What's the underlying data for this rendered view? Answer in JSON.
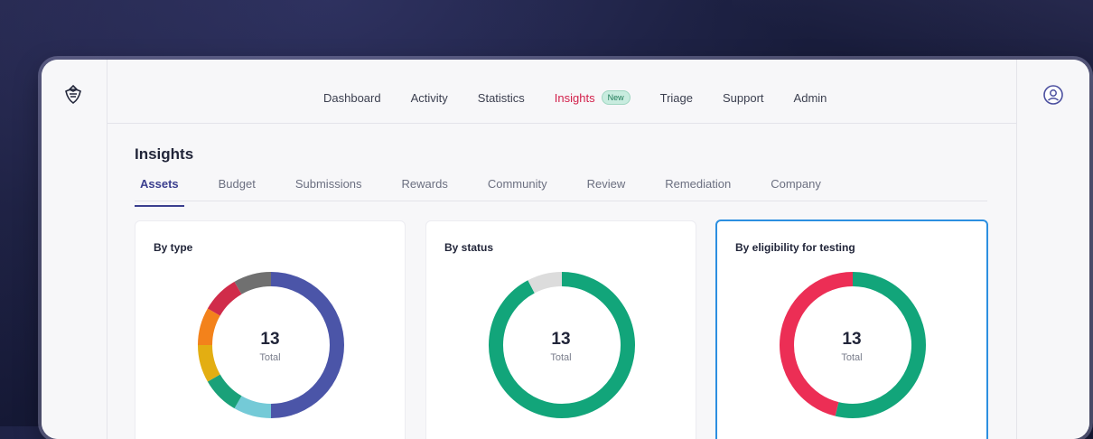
{
  "nav": {
    "items": [
      {
        "label": "Dashboard"
      },
      {
        "label": "Activity"
      },
      {
        "label": "Statistics"
      },
      {
        "label": "Insights",
        "badge": "New"
      },
      {
        "label": "Triage"
      },
      {
        "label": "Support"
      },
      {
        "label": "Admin"
      }
    ],
    "active_label": "Insights"
  },
  "page": {
    "title": "Insights"
  },
  "tabs": [
    "Assets",
    "Budget",
    "Submissions",
    "Rewards",
    "Community",
    "Review",
    "Remediation",
    "Company"
  ],
  "active_tab": "Assets",
  "cards": [
    {
      "title": "By type",
      "total": "13",
      "total_label": "Total",
      "segments": [
        {
          "value": 6,
          "color": "#4b55a8"
        },
        {
          "value": 1,
          "color": "#74cad7"
        },
        {
          "value": 1,
          "color": "#1aa179"
        },
        {
          "value": 1,
          "color": "#e3ae12"
        },
        {
          "value": 1,
          "color": "#f3821b"
        },
        {
          "value": 1,
          "color": "#d02c4a"
        },
        {
          "value": 1,
          "color": "#707070"
        }
      ]
    },
    {
      "title": "By status",
      "total": "13",
      "total_label": "Total",
      "segments": [
        {
          "value": 12,
          "color": "#12a57a"
        },
        {
          "value": 1,
          "color": "#dcdcdc"
        }
      ]
    },
    {
      "title": "By eligibility for testing",
      "total": "13",
      "total_label": "Total",
      "segments": [
        {
          "value": 7,
          "color": "#12a57a"
        },
        {
          "value": 6,
          "color": "#ec2e55"
        }
      ]
    }
  ],
  "colors": {
    "accent": "#d21f4a",
    "tab_active": "#3b3f8f",
    "selected_border": "#2c8fe0"
  },
  "icons": {
    "logo": "bug-bounty-logo-icon",
    "user": "user-account-icon"
  }
}
